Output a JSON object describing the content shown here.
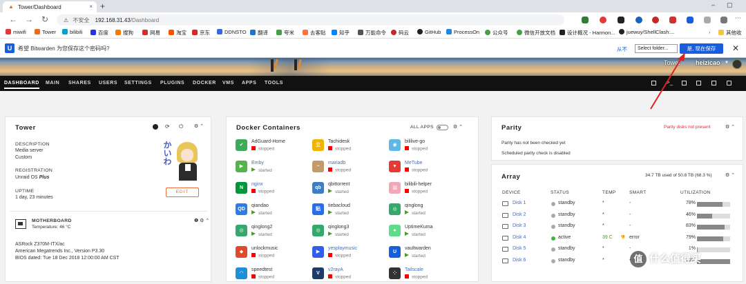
{
  "browser": {
    "tab_title": "Tower/Dashboard",
    "tab_close": "×",
    "new_tab": "+",
    "win_min": "–",
    "win_max": "▢",
    "nav_back": "←",
    "nav_forward": "→",
    "nav_reload": "↻",
    "security_label": "不安全",
    "url_host": "192.168.31.43",
    "url_path": "/Dashboard"
  },
  "bookmarks": [
    "miwifi",
    "Tower",
    "bilibili",
    "百度",
    "搜狗",
    "网易",
    "淘宝",
    "京东",
    "DDNSTO",
    "翻译",
    "夸米",
    "去客贴",
    "知乎",
    "万能命令",
    "码云",
    "GitHub",
    "ProcessOn",
    "公众号",
    "微信开放文档",
    "设计概况 - Harmon...",
    "juewuy/ShellClash:...",
    "其他收"
  ],
  "password_bar": {
    "logo": "U",
    "prompt": "希望 Bitwarden 为您保存这个密码吗?",
    "never": "从不",
    "folder_select": "Select folder...",
    "save_button": "是, 现在保存",
    "close": "✕"
  },
  "header": {
    "server_name": "Tower",
    "username": "heizicao"
  },
  "menu": [
    "DASHBOARD",
    "MAIN",
    "SHARES",
    "USERS",
    "SETTINGS",
    "PLUGINS",
    "DOCKER",
    "VMS",
    "APPS",
    "TOOLS"
  ],
  "tower": {
    "title": "Tower",
    "description_label": "DESCRIPTION",
    "description_lines": [
      "Media server",
      "Custom"
    ],
    "registration_label": "REGISTRATION",
    "registration_value": "Unraid OS ",
    "registration_plan": "Plus",
    "uptime_label": "UPTIME",
    "uptime_value": "1 day, 23 minutes",
    "edit_button": "EDIT",
    "avatar_text": "かいわ"
  },
  "motherboard": {
    "title": "MOTHERBOARD",
    "temperature": "Temperature: 46 °C",
    "model": "ASRock Z370M-ITX/ac",
    "bios_vendor": "American Megatrends Inc., Version P3.30",
    "bios_date": "BIOS dated: Tue 18 Dec 2018 12:00:00 AM CST"
  },
  "docker": {
    "title": "Docker Containers",
    "all_apps": "ALL APPS",
    "containers": [
      {
        "name": "AdGuard-Home",
        "state": "stopped",
        "color": "#3eaa5b",
        "glyph": "✔"
      },
      {
        "name": "Tachidesk",
        "state": "stopped",
        "color": "#f0b400",
        "glyph": "立"
      },
      {
        "name": "bililive-go",
        "state": "stopped",
        "color": "#5fb7e5",
        "glyph": "◉"
      },
      {
        "name": "Emby",
        "state": "started",
        "color": "#52b54b",
        "glyph": "▶"
      },
      {
        "name": "mariadb",
        "state": "stopped",
        "color": "#c49a6c",
        "glyph": "~"
      },
      {
        "name": "MeTube",
        "state": "stopped",
        "color": "#e53935",
        "glyph": "▼"
      },
      {
        "name": "nginx",
        "state": "stopped",
        "color": "#009639",
        "glyph": "N"
      },
      {
        "name": "qbittorrent",
        "state": "started",
        "color": "#3f7cc0",
        "glyph": "qb"
      },
      {
        "name": "bilibili-helper",
        "state": "stopped",
        "color": "#f4a7b9",
        "glyph": "▥"
      },
      {
        "name": "qiandao",
        "state": "started",
        "color": "#2b7de9",
        "glyph": "QD"
      },
      {
        "name": "tiebacloud",
        "state": "started",
        "color": "#2b6de9",
        "glyph": "贴"
      },
      {
        "name": "qinglong",
        "state": "started",
        "color": "#35a86b",
        "glyph": "◎"
      },
      {
        "name": "qinglong2",
        "state": "started",
        "color": "#35a86b",
        "glyph": "◎"
      },
      {
        "name": "qinglong3",
        "state": "started",
        "color": "#35a86b",
        "glyph": "◎"
      },
      {
        "name": "UptimeKuma",
        "state": "started",
        "color": "#5cdd8b",
        "glyph": "●"
      },
      {
        "name": "unlockmusic",
        "state": "stopped",
        "color": "#e04a2a",
        "glyph": "◆"
      },
      {
        "name": "yesplaymusic",
        "state": "stopped",
        "color": "#335eea",
        "glyph": "▶"
      },
      {
        "name": "vaultwarden",
        "state": "started",
        "color": "#175ddc",
        "glyph": "U"
      },
      {
        "name": "speedtest",
        "state": "stopped",
        "color": "#1f8fd6",
        "glyph": "◠"
      },
      {
        "name": "v2rayA",
        "state": "stopped",
        "color": "#1f3a68",
        "glyph": "V"
      },
      {
        "name": "Tailscale",
        "state": "stopped",
        "color": "#333333",
        "glyph": "⁘"
      }
    ]
  },
  "parity": {
    "title": "Parity",
    "status_alert": "Parity disks not present",
    "line1": "Parity has not been checked yet",
    "line2": "Scheduled parity check is disabled"
  },
  "array": {
    "title": "Array",
    "summary": "34.7 TB used of 50.8 TB (68.3 %)",
    "columns": [
      "DEVICE",
      "STATUS",
      "TEMP",
      "SMART",
      "UTILIZATION"
    ],
    "disks": [
      {
        "name": "Disk 1",
        "status": "standby",
        "temp": "*",
        "smart": "-",
        "utilization": 78
      },
      {
        "name": "Disk 2",
        "status": "standby",
        "temp": "*",
        "smart": "-",
        "utilization": 46
      },
      {
        "name": "Disk 3",
        "status": "standby",
        "temp": "*",
        "smart": "-",
        "utilization": 83
      },
      {
        "name": "Disk 4",
        "status": "active",
        "temp": "39 C",
        "smart": "error",
        "utilization": 79
      },
      {
        "name": "Disk 5",
        "status": "standby",
        "temp": "*",
        "smart": "-",
        "utilization": 1
      },
      {
        "name": "Disk 6",
        "status": "standby",
        "temp": "*",
        "smart": "-",
        "utilization": 99
      }
    ]
  },
  "watermark": {
    "text": "什么值得买",
    "glyph": "值"
  }
}
